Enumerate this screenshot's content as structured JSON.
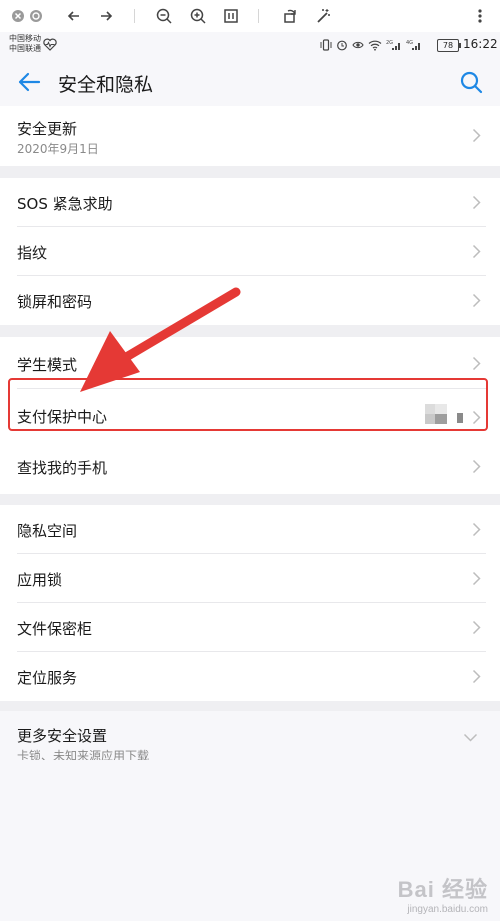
{
  "status_bar": {
    "carrier_1": "中国移动",
    "carrier_2": "中国联通",
    "battery": "78",
    "time": "16:22",
    "signal_labels": [
      "2G",
      "4G"
    ]
  },
  "header": {
    "title": "安全和隐私",
    "back_icon": "arrow-left-icon",
    "search_icon": "search-icon"
  },
  "groups": [
    {
      "items": [
        {
          "label": "安全更新",
          "sub": "2020年9月1日"
        }
      ]
    },
    {
      "items": [
        {
          "label": "SOS 紧急求助"
        },
        {
          "label": "指纹"
        },
        {
          "label": "锁屏和密码"
        }
      ]
    },
    {
      "items": [
        {
          "label": "学生模式"
        },
        {
          "label": "支付保护中心"
        },
        {
          "label": "查找我的手机"
        }
      ]
    },
    {
      "items": [
        {
          "label": "隐私空间"
        },
        {
          "label": "应用锁"
        },
        {
          "label": "文件保密柜"
        },
        {
          "label": "定位服务"
        }
      ]
    },
    {
      "items": [
        {
          "label": "更多安全设置",
          "sub": "卡锁、未知来源应用下载"
        }
      ]
    }
  ],
  "watermark": {
    "logo": "Bai 经验",
    "url": "jingyan.baidu.com"
  },
  "colors": {
    "accent": "#1e88e5",
    "highlight": "#e53935",
    "background": "#f7f7fa"
  }
}
